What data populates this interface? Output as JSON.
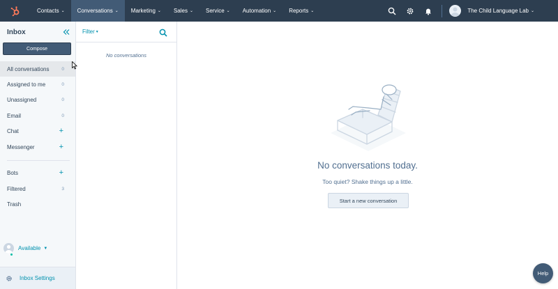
{
  "topnav": {
    "items": [
      {
        "label": "Contacts"
      },
      {
        "label": "Conversations"
      },
      {
        "label": "Marketing"
      },
      {
        "label": "Sales"
      },
      {
        "label": "Service"
      },
      {
        "label": "Automation"
      },
      {
        "label": "Reports"
      }
    ],
    "active_index": 1,
    "account_name": "The Child Language Lab",
    "icons": [
      "search-icon",
      "gear-icon",
      "bell-icon"
    ],
    "colors": {
      "bar": "#2d3e50",
      "active": "#425b76",
      "logo": "#ff7a59"
    }
  },
  "sidebar": {
    "title": "Inbox",
    "compose_label": "Compose",
    "items": [
      {
        "label": "All conversations",
        "count": "0"
      },
      {
        "label": "Assigned to me",
        "count": "0"
      },
      {
        "label": "Unassigned",
        "count": "0"
      },
      {
        "label": "Email",
        "count": "0"
      },
      {
        "label": "Chat",
        "action": "+"
      },
      {
        "label": "Messenger",
        "action": "+"
      },
      {
        "label": "Bots",
        "action": "+"
      },
      {
        "label": "Filtered",
        "count": "3"
      },
      {
        "label": "Trash"
      }
    ],
    "status_label": "Available",
    "settings_label": "Inbox Settings"
  },
  "list": {
    "filter_label": "Filter",
    "empty_label": "No conversations"
  },
  "main": {
    "empty_title": "No conversations today.",
    "empty_subtitle": "Too quiet? Shake things up a little.",
    "start_button": "Start a new conversation"
  },
  "help_label": "Help",
  "accent_color": "#0091ae"
}
